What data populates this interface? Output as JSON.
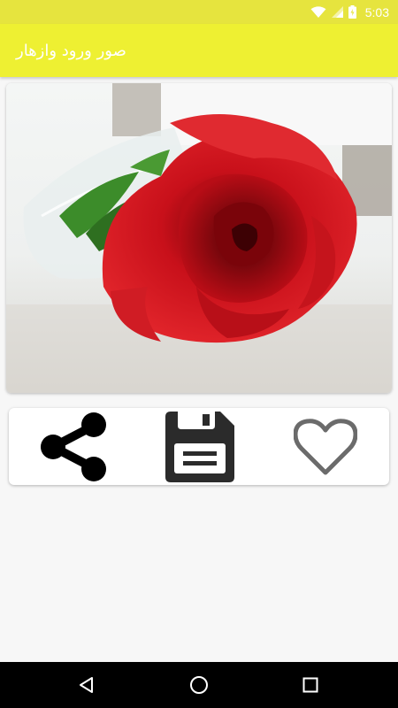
{
  "status_bar": {
    "time": "5:03",
    "icons": [
      "wifi-icon",
      "cellular-signal-icon",
      "battery-icon"
    ],
    "background_color": "#e6e43e"
  },
  "app_bar": {
    "title": "صور ورود وازهار",
    "background_color": "#eef032",
    "title_color": "#ffffff"
  },
  "image_card": {
    "content": "red-rose-photo"
  },
  "actions": {
    "items": [
      {
        "id": "share",
        "icon": "share-icon"
      },
      {
        "id": "save",
        "icon": "floppy-disk-icon"
      },
      {
        "id": "favorite",
        "icon": "heart-outline-icon"
      }
    ]
  },
  "navigation_bar": {
    "buttons": [
      "back-icon",
      "home-icon",
      "recent-apps-icon"
    ],
    "background_color": "#000000"
  }
}
